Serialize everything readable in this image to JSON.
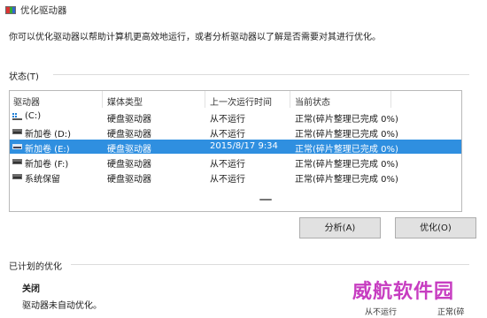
{
  "window": {
    "title": "优化驱动器",
    "icon": "optimize-drives-icon"
  },
  "description": "你可以优化驱动器以帮助计算机更高效地运行，或者分析驱动器以了解是否需要对其进行优化。",
  "status_section": {
    "label": "状态(T)",
    "columns": [
      "驱动器",
      "媒体类型",
      "上一次运行时间",
      "当前状态"
    ],
    "rows": [
      {
        "drive": "(C:)",
        "icon": "system-drive-icon",
        "media": "硬盘驱动器",
        "last_run": "从不运行",
        "status": "正常(碎片整理已完成 0%)",
        "selected": false
      },
      {
        "drive": "新加卷 (D:)",
        "icon": "hard-drive-icon",
        "media": "硬盘驱动器",
        "last_run": "从不运行",
        "status": "正常(碎片整理已完成 0%)",
        "selected": false
      },
      {
        "drive": "新加卷 (E:)",
        "icon": "hard-drive-icon",
        "media": "硬盘驱动器",
        "last_run": "2015/8/17 9:34",
        "status": "正常(碎片整理已完成 0%)",
        "selected": true
      },
      {
        "drive": "新加卷 (F:)",
        "icon": "hard-drive-icon",
        "media": "硬盘驱动器",
        "last_run": "从不运行",
        "status": "正常(碎片整理已完成 0%)",
        "selected": false
      },
      {
        "drive": "系统保留",
        "icon": "hard-drive-icon",
        "media": "硬盘驱动器",
        "last_run": "从不运行",
        "status": "正常(碎片整理已完成 0%)",
        "selected": false
      }
    ]
  },
  "buttons": {
    "analyze": "分析(A)",
    "optimize": "优化(O)"
  },
  "scheduled": {
    "label": "已计划的优化",
    "status": "关闭",
    "description": "驱动器未自动优化。",
    "cut_off_left": "从不运行",
    "cut_off_right": "正常(碎"
  },
  "watermark": "威航软件园",
  "colors": {
    "selection": "#2f8fe0",
    "watermark": "#c73dc1"
  }
}
